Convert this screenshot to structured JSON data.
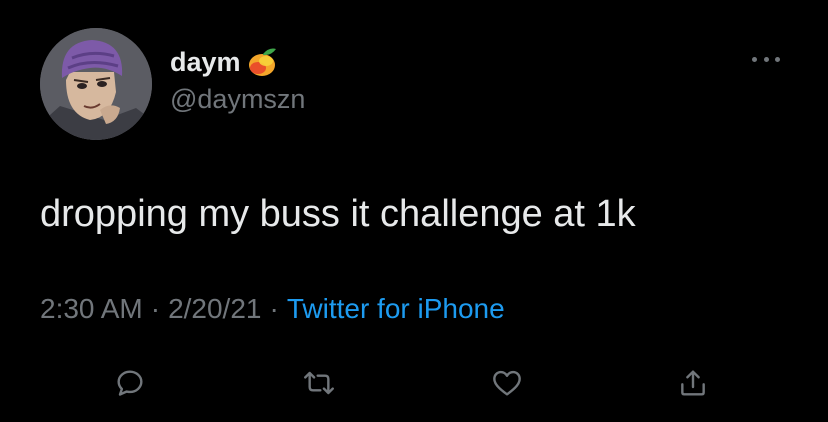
{
  "tweet": {
    "display_name": "daym",
    "handle": "@daymszn",
    "text": "dropping my buss it challenge at 1k",
    "time": "2:30 AM",
    "separator": "·",
    "date": "2/20/21",
    "source": "Twitter for iPhone",
    "name_emoji_icon": "mango-emoji"
  },
  "actions": [
    {
      "icon": "reply-icon"
    },
    {
      "icon": "retweet-icon"
    },
    {
      "icon": "like-icon"
    },
    {
      "icon": "share-icon"
    }
  ],
  "colors": {
    "background": "#000000",
    "primary_text": "#e7e9ea",
    "secondary_text": "#71767b",
    "link": "#1d9bf0"
  }
}
